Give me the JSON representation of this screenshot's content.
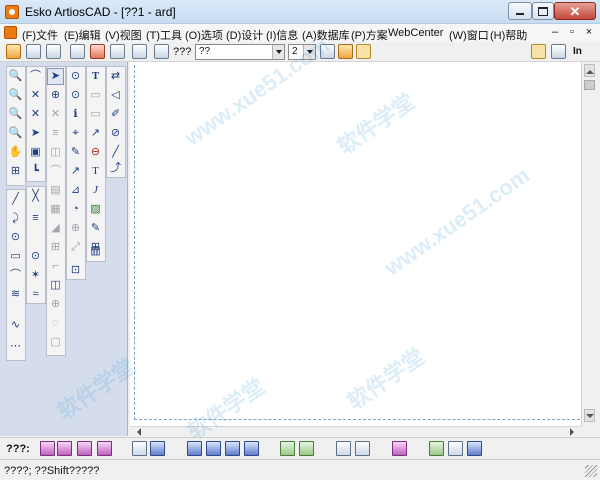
{
  "window": {
    "title": "Esko ArtiosCAD - [??1 - ard]",
    "close_glyph": "✕"
  },
  "menu": {
    "items": [
      "(F)文件",
      "(E)编辑",
      "(V)视图",
      "(T)工具",
      "(O)选项",
      "(D)设计",
      "(I)信息",
      "(A)数据库",
      "(P)方案",
      "WebCenter",
      "(W)窗口",
      "(H)帮助"
    ],
    "mdi_controls": [
      "–",
      "▫",
      "×"
    ]
  },
  "toolbar": {
    "layer_label": "???",
    "combo1_value": "??",
    "combo2_value": "2",
    "unit_label": "In"
  },
  "palette": {
    "col1": [
      "🔍",
      "🔍",
      "🔍",
      "🔍",
      "✋",
      "⊞",
      "╱",
      "⤸",
      "⊙",
      "▭",
      "⌒",
      "≋",
      "∿",
      "⋯"
    ],
    "col2": [
      "⌒",
      "✕",
      "✕",
      "➤",
      "▣",
      "┗",
      "╳",
      "≡",
      "⊙",
      "✶",
      "≈"
    ],
    "col3": [
      "➤",
      "⊕",
      "✕",
      "≡",
      "◫",
      "⌒",
      "▤",
      "▦",
      "◢",
      "⊞",
      "⌐",
      "◫",
      "⊕",
      "◌",
      "▢",
      "▢"
    ],
    "col4": [
      "⊙",
      "⊙",
      "ℹ",
      "⌖",
      "✎",
      "↗",
      "⊿",
      "◔",
      "⊕",
      "⤢",
      "⊡"
    ],
    "col5": [
      "T",
      "▭",
      "▭",
      "↗",
      "⊖",
      "T",
      "J",
      "▨",
      "✎",
      "⊞",
      "▥"
    ],
    "col6": [
      "⇄",
      "◁",
      "✐",
      "⊘",
      "╱",
      "⤴"
    ]
  },
  "bottombar": {
    "label": "???:"
  },
  "status": {
    "text": "????; ??Shift?????"
  },
  "watermark": {
    "cn": "软件学堂",
    "url": "www.xue51.com"
  },
  "colors": {
    "accent": "#f07a12",
    "palette_bg": "#d5ddec",
    "canvas_border": "#7aa2d6"
  }
}
